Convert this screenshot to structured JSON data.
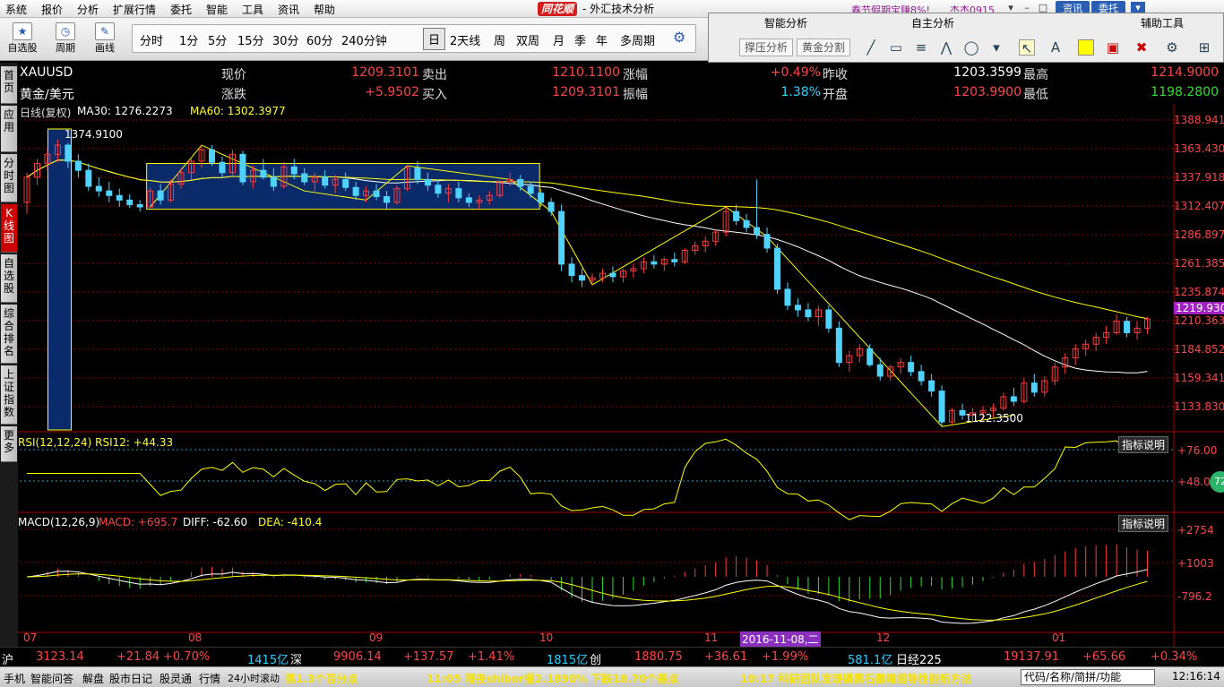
{
  "menubar": {
    "items": [
      "系统",
      "报价",
      "分析",
      "扩展行情",
      "委托",
      "智能",
      "工具",
      "资讯",
      "帮助"
    ],
    "logo": "同花顺",
    "title": "- 外汇技术分析",
    "ticker": "春节假期宝赚8%!",
    "user": "杰杰0915",
    "btn_info": "资讯",
    "btn_trade": "委托"
  },
  "toolbar": {
    "select_stock": "自选股",
    "period": "周期",
    "draw": "画线",
    "periods": [
      "分时",
      "1分",
      "5分",
      "15分",
      "30分",
      "60分",
      "240分钟",
      "日",
      "2天线",
      "周",
      "双周",
      "月",
      "季",
      "年",
      "多周期"
    ],
    "selected_period": "日"
  },
  "side_panel": {
    "smart_analysis": "智能分析",
    "self_analysis": "自主分析",
    "aux_tools": "辅助工具",
    "pressure_btn": "撑压分析",
    "gold_split_btn": "黄金分割"
  },
  "left_tabs": [
    "首页",
    "应用",
    "分时图",
    "K线图",
    "自选股",
    "综合排名",
    "上证指数",
    "更多"
  ],
  "quote": {
    "symbol": "XAUUSD",
    "name": "黄金/美元",
    "now_label": "现价",
    "now": "1209.3101",
    "change_label": "涨跌",
    "change": "+5.9502",
    "sell_label": "卖出",
    "sell": "1210.1100",
    "buy_label": "买入",
    "buy": "1209.3101",
    "pct_label": "涨幅",
    "pct": "+0.49%",
    "amp_label": "振幅",
    "amp": "1.38%",
    "prev_label": "昨收",
    "prev": "1203.3599",
    "open_label": "开盘",
    "open": "1203.9900",
    "high_label": "最高",
    "high": "1214.9000",
    "low_label": "最低",
    "low": "1198.2800"
  },
  "indicators": {
    "main_title": "日线(复权)",
    "ma30": "MA30: 1276.2273",
    "ma60": "MA60: 1302.3977",
    "rsi": "RSI(12,12,24) RSI12: +44.33",
    "macd_title": "MACD(12,26,9)",
    "macd_val": "MACD: +695.7",
    "diff": "DIFF: -62.60",
    "dea": "DEA: -410.4",
    "explain": "指标说明"
  },
  "chart_data": {
    "type": "candlestick",
    "price_axis": [
      "1388.941",
      "1363.430",
      "1337.918",
      "1312.407",
      "1286.897",
      "1261.385",
      "1235.874",
      "1210.363",
      "1184.852",
      "1159.341",
      "1133.830"
    ],
    "price_range": [
      1121.0,
      1392.0
    ],
    "current_price_tag": "1219.930",
    "high_annotation": "1374.9100",
    "low_annotation": "1122.3500",
    "date_ticks": [
      "07",
      "08",
      "09",
      "10",
      "11",
      "12",
      "01"
    ],
    "hover_date": "2016-11-08,二",
    "rsi_axis": [
      "+76.00",
      "+48.07"
    ],
    "rsi_badge": "72",
    "macd_axis": [
      "+2754",
      "+1003",
      "-796.2"
    ],
    "colors": {
      "up": "#ff3c3c",
      "down": "#50d2ff",
      "ma30": "#ffffff",
      "ma60": "#ffff00",
      "grid": "#8b0000"
    },
    "ohlc": [
      [
        1320,
        1346,
        1310,
        1342
      ],
      [
        1342,
        1358,
        1335,
        1354
      ],
      [
        1354,
        1366,
        1348,
        1362
      ],
      [
        1362,
        1375,
        1355,
        1370
      ],
      [
        1370,
        1372,
        1350,
        1356
      ],
      [
        1356,
        1362,
        1342,
        1348
      ],
      [
        1348,
        1354,
        1330,
        1334
      ],
      [
        1334,
        1342,
        1325,
        1330
      ],
      [
        1330,
        1338,
        1320,
        1326
      ],
      [
        1326,
        1332,
        1316,
        1322
      ],
      [
        1322,
        1327,
        1315,
        1318
      ],
      [
        1318,
        1322,
        1312,
        1316
      ],
      [
        1316,
        1333,
        1314,
        1330
      ],
      [
        1330,
        1336,
        1318,
        1322
      ],
      [
        1322,
        1340,
        1320,
        1336
      ],
      [
        1336,
        1350,
        1332,
        1346
      ],
      [
        1346,
        1360,
        1340,
        1356
      ],
      [
        1356,
        1370,
        1350,
        1366
      ],
      [
        1366,
        1370,
        1352,
        1355
      ],
      [
        1355,
        1360,
        1342,
        1346
      ],
      [
        1346,
        1366,
        1344,
        1362
      ],
      [
        1362,
        1365,
        1335,
        1338
      ],
      [
        1338,
        1352,
        1332,
        1348
      ],
      [
        1348,
        1358,
        1340,
        1342
      ],
      [
        1342,
        1350,
        1330,
        1334
      ],
      [
        1334,
        1355,
        1332,
        1351
      ],
      [
        1351,
        1358,
        1340,
        1345
      ],
      [
        1345,
        1350,
        1335,
        1338
      ],
      [
        1338,
        1346,
        1330,
        1342
      ],
      [
        1342,
        1348,
        1332,
        1335
      ],
      [
        1335,
        1344,
        1328,
        1340
      ],
      [
        1340,
        1346,
        1330,
        1333
      ],
      [
        1333,
        1338,
        1322,
        1326
      ],
      [
        1326,
        1334,
        1320,
        1330
      ],
      [
        1330,
        1336,
        1322,
        1325
      ],
      [
        1325,
        1330,
        1314,
        1320
      ],
      [
        1320,
        1335,
        1318,
        1332
      ],
      [
        1332,
        1352,
        1330,
        1350
      ],
      [
        1350,
        1356,
        1336,
        1340
      ],
      [
        1340,
        1346,
        1330,
        1335
      ],
      [
        1335,
        1340,
        1324,
        1328
      ],
      [
        1328,
        1336,
        1320,
        1332
      ],
      [
        1332,
        1338,
        1320,
        1324
      ],
      [
        1324,
        1328,
        1316,
        1320
      ],
      [
        1320,
        1326,
        1314,
        1322
      ],
      [
        1322,
        1330,
        1318,
        1326
      ],
      [
        1326,
        1340,
        1324,
        1338
      ],
      [
        1338,
        1346,
        1334,
        1340
      ],
      [
        1340,
        1344,
        1330,
        1334
      ],
      [
        1334,
        1338,
        1324,
        1328
      ],
      [
        1328,
        1332,
        1316,
        1320
      ],
      [
        1320,
        1324,
        1308,
        1312
      ],
      [
        1312,
        1318,
        1260,
        1266
      ],
      [
        1266,
        1272,
        1250,
        1256
      ],
      [
        1256,
        1262,
        1246,
        1252
      ],
      [
        1252,
        1258,
        1248,
        1254
      ],
      [
        1254,
        1262,
        1250,
        1258
      ],
      [
        1258,
        1264,
        1250,
        1255
      ],
      [
        1255,
        1262,
        1250,
        1260
      ],
      [
        1260,
        1266,
        1254,
        1262
      ],
      [
        1262,
        1272,
        1258,
        1268
      ],
      [
        1268,
        1274,
        1262,
        1266
      ],
      [
        1266,
        1272,
        1260,
        1270
      ],
      [
        1270,
        1276,
        1264,
        1268
      ],
      [
        1268,
        1280,
        1266,
        1278
      ],
      [
        1278,
        1286,
        1274,
        1282
      ],
      [
        1282,
        1290,
        1276,
        1286
      ],
      [
        1286,
        1296,
        1282,
        1294
      ],
      [
        1294,
        1316,
        1290,
        1312
      ],
      [
        1312,
        1318,
        1300,
        1304
      ],
      [
        1304,
        1310,
        1294,
        1298
      ],
      [
        1298,
        1340,
        1288,
        1292
      ],
      [
        1292,
        1298,
        1276,
        1280
      ],
      [
        1280,
        1284,
        1240,
        1244
      ],
      [
        1244,
        1250,
        1226,
        1230
      ],
      [
        1230,
        1236,
        1220,
        1226
      ],
      [
        1226,
        1232,
        1216,
        1220
      ],
      [
        1220,
        1230,
        1212,
        1226
      ],
      [
        1226,
        1230,
        1206,
        1210
      ],
      [
        1210,
        1216,
        1176,
        1180
      ],
      [
        1180,
        1190,
        1172,
        1186
      ],
      [
        1186,
        1196,
        1180,
        1192
      ],
      [
        1192,
        1196,
        1176,
        1178
      ],
      [
        1178,
        1184,
        1164,
        1168
      ],
      [
        1168,
        1178,
        1164,
        1176
      ],
      [
        1176,
        1184,
        1170,
        1180
      ],
      [
        1180,
        1186,
        1168,
        1172
      ],
      [
        1172,
        1178,
        1160,
        1164
      ],
      [
        1164,
        1170,
        1150,
        1155
      ],
      [
        1155,
        1160,
        1124,
        1128
      ],
      [
        1128,
        1140,
        1126,
        1138
      ],
      [
        1138,
        1144,
        1130,
        1134
      ],
      [
        1134,
        1140,
        1128,
        1136
      ],
      [
        1136,
        1142,
        1130,
        1138
      ],
      [
        1138,
        1144,
        1132,
        1140
      ],
      [
        1140,
        1154,
        1138,
        1150
      ],
      [
        1150,
        1158,
        1142,
        1146
      ],
      [
        1146,
        1166,
        1144,
        1162
      ],
      [
        1162,
        1170,
        1150,
        1154
      ],
      [
        1154,
        1168,
        1150,
        1164
      ],
      [
        1164,
        1180,
        1160,
        1176
      ],
      [
        1176,
        1188,
        1170,
        1184
      ],
      [
        1184,
        1196,
        1178,
        1192
      ],
      [
        1192,
        1200,
        1186,
        1196
      ],
      [
        1196,
        1206,
        1190,
        1202
      ],
      [
        1202,
        1212,
        1196,
        1206
      ],
      [
        1206,
        1222,
        1204,
        1216
      ],
      [
        1216,
        1220,
        1202,
        1206
      ],
      [
        1206,
        1216,
        1200,
        1210
      ],
      [
        1210,
        1220,
        1205,
        1218
      ]
    ]
  },
  "status": {
    "sh_label": "沪",
    "sh": "3123.14",
    "sh_chg": "+21.84",
    "sh_pct": "+0.70%",
    "sh_amt": "1415亿",
    "sz_label": "深",
    "sz": "9906.14",
    "sz_chg": "+137.57",
    "sz_pct": "+1.41%",
    "sz_amt": "1815亿",
    "cy_label": "创",
    "cy": "1880.75",
    "cy_chg": "+36.61",
    "cy_pct": "+1.99%",
    "cy_amt": "581.1亿",
    "nk_label": "日经225",
    "nk": "19137.91",
    "nk_chg": "+65.66",
    "nk_pct": "+0.34%"
  },
  "bottom": {
    "items": [
      "手机",
      "智能问答",
      "解盘",
      "股市日记",
      "股灵通",
      "行情",
      "24小时滚动"
    ],
    "news1": "落1.3个百分点",
    "news2": "11:05 隔夜shibor报2.1890% 下跌18.70个基点",
    "news3": "10:17 科研团队发现磷黑石墨烯超导性能新方法",
    "search": "代码/名称/简拼/功能",
    "clock": "12:16:14"
  }
}
